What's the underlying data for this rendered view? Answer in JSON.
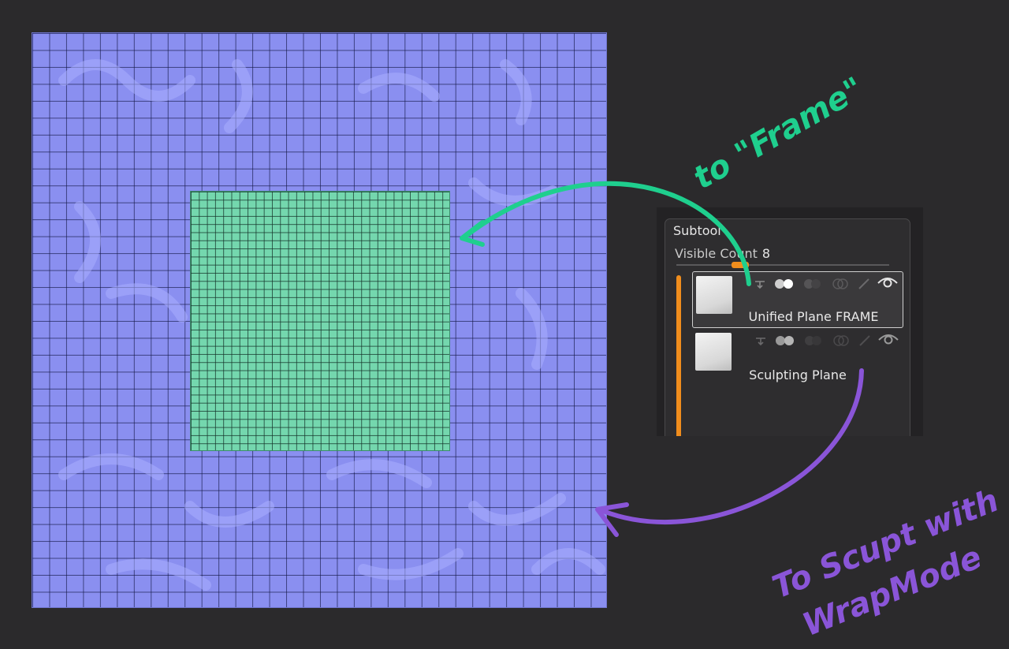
{
  "panel": {
    "title": "Subtool",
    "visible_count_label": "Visible Count",
    "visible_count_value": "8",
    "slider_level": 0.3,
    "subtools": [
      {
        "name": "Unified Plane FRAME",
        "selected": true
      },
      {
        "name": "Sculpting Plane",
        "selected": false
      }
    ]
  },
  "annotations": {
    "frame_note": "to \"Frame\"",
    "wrap_note_line1": "To Scupt with",
    "wrap_note_line2": "WrapMode",
    "frame_color": "#1fcf8e",
    "wrap_color": "#8a55d8"
  },
  "colors": {
    "background": "#2b2a2c",
    "outer_plane": "#8a8ff0",
    "inner_plane": "#74d7ae",
    "accent": "#f08d1d"
  },
  "icons": [
    "move-down-icon",
    "visibility-circles-icon",
    "polyframe-icon",
    "solo-icon",
    "brush-icon",
    "eye-icon"
  ]
}
